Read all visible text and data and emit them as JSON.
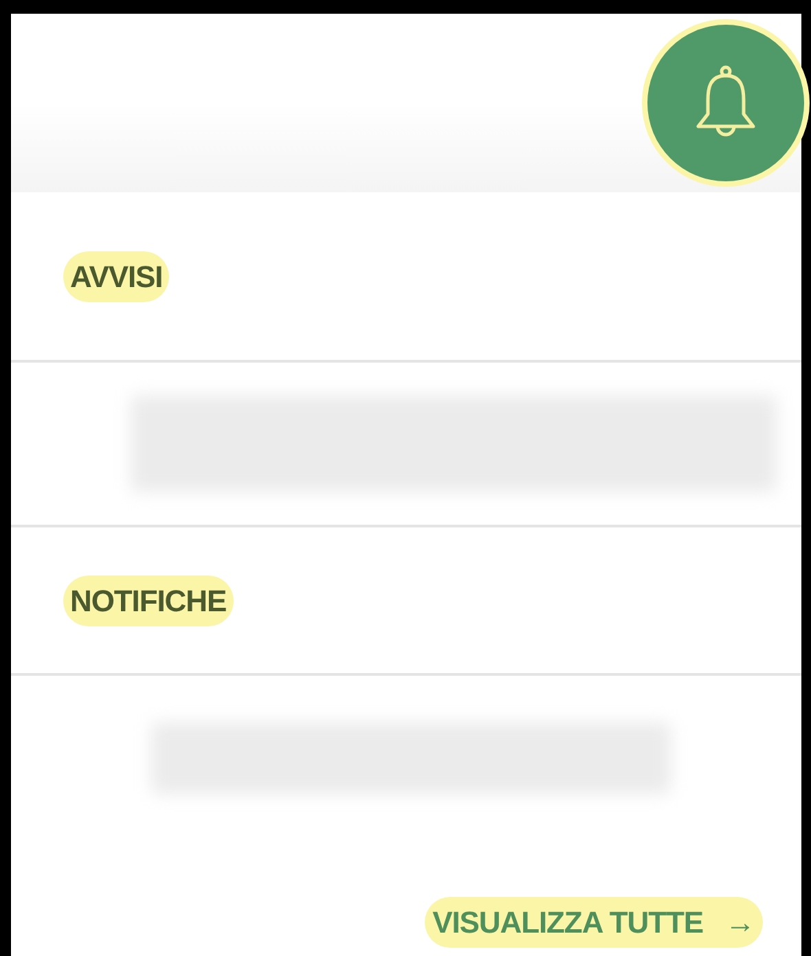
{
  "bell_button": {
    "highlighted": true
  },
  "sections": [
    {
      "title": "AVVISI",
      "highlighted": true
    },
    {
      "title": "NOTIFICHE",
      "highlighted": true
    }
  ],
  "footer_link": {
    "label": "VISUALIZZA TUTTE",
    "arrow": "→",
    "highlighted": true
  }
}
